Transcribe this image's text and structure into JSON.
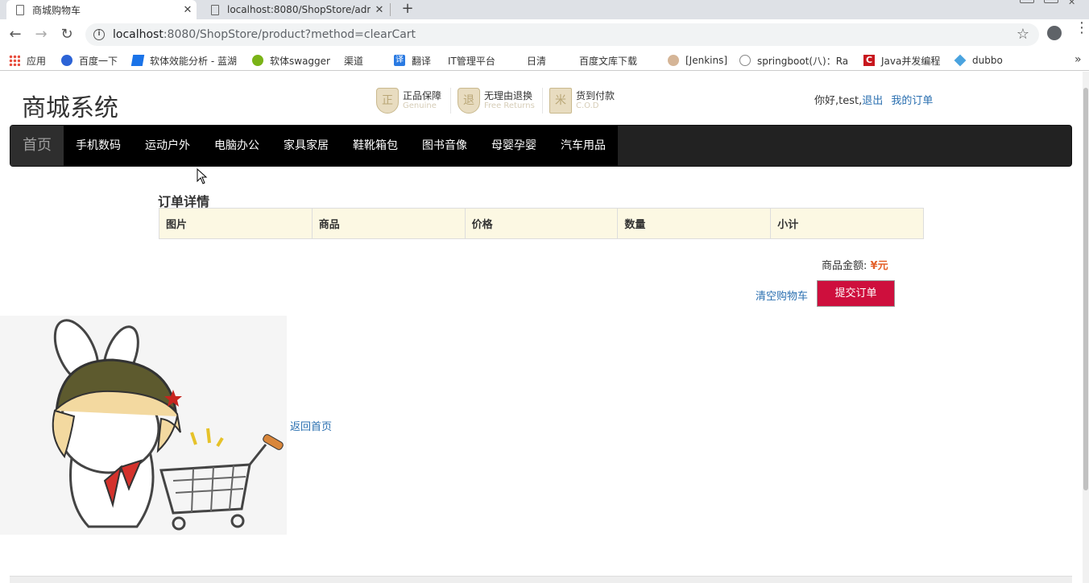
{
  "browser": {
    "tabs": [
      {
        "title": "商城购物车",
        "active": true
      },
      {
        "title": "localhost:8080/ShopStore/adm",
        "active": false
      }
    ],
    "url": {
      "host": "localhost",
      "rest": ":8080/ShopStore/product?method=clearCart"
    },
    "bookmarks": [
      {
        "label": "应用",
        "icon": "apps-grid-icon"
      },
      {
        "label": "百度一下",
        "icon": "baidu-paw-icon"
      },
      {
        "label": "软体效能分析 - 蓝湖",
        "icon": "lanhu-icon"
      },
      {
        "label": "软体swagger",
        "icon": "swagger-icon"
      },
      {
        "label": "渠道",
        "icon": "page-icon"
      },
      {
        "label": "翻译",
        "icon": "translate-icon"
      },
      {
        "label": "IT管理平台",
        "icon": "page-icon"
      },
      {
        "label": "日清",
        "icon": "page-icon"
      },
      {
        "label": "百度文库下载",
        "icon": "page-icon"
      },
      {
        "label": "[Jenkins]",
        "icon": "jenkins-icon"
      },
      {
        "label": "springboot(八)：Ra",
        "icon": "springboot-icon"
      },
      {
        "label": "Java并发编程",
        "icon": "csdn-icon"
      },
      {
        "label": "dubbo",
        "icon": "dubbo-icon"
      }
    ],
    "more_label": "»"
  },
  "header": {
    "site_title": "商城系统",
    "guarantees": [
      {
        "cn": "正品保障",
        "en": "Genuine",
        "glyph": "正"
      },
      {
        "cn": "无理由退换",
        "en": "Free Returns",
        "glyph": "退"
      },
      {
        "cn": "货到付款",
        "en": "C.O.D",
        "glyph": "米"
      }
    ],
    "greeting": "你好,test,",
    "logout_label": "退出",
    "my_orders_label": "我的订单"
  },
  "nav": {
    "home_label": "首页",
    "items": [
      "手机数码",
      "运动户外",
      "电脑办公",
      "家具家居",
      "鞋靴箱包",
      "图书音像",
      "母婴孕婴",
      "汽车用品"
    ]
  },
  "order": {
    "title": "订单详情",
    "columns": [
      "图片",
      "商品",
      "价格",
      "数量",
      "小计"
    ],
    "amount_label": "商品金额:",
    "amount_value": "¥元",
    "clear_cart_label": "清空购物车",
    "submit_label": "提交订单"
  },
  "empty_cart": {
    "back_home_label": "返回首页"
  },
  "colors": {
    "nav_bg": "#222222",
    "submit_bg": "#ce0f3d",
    "table_header_bg": "#fcf8e3",
    "link": "#2a6fb0",
    "amount": "#e4612b"
  }
}
